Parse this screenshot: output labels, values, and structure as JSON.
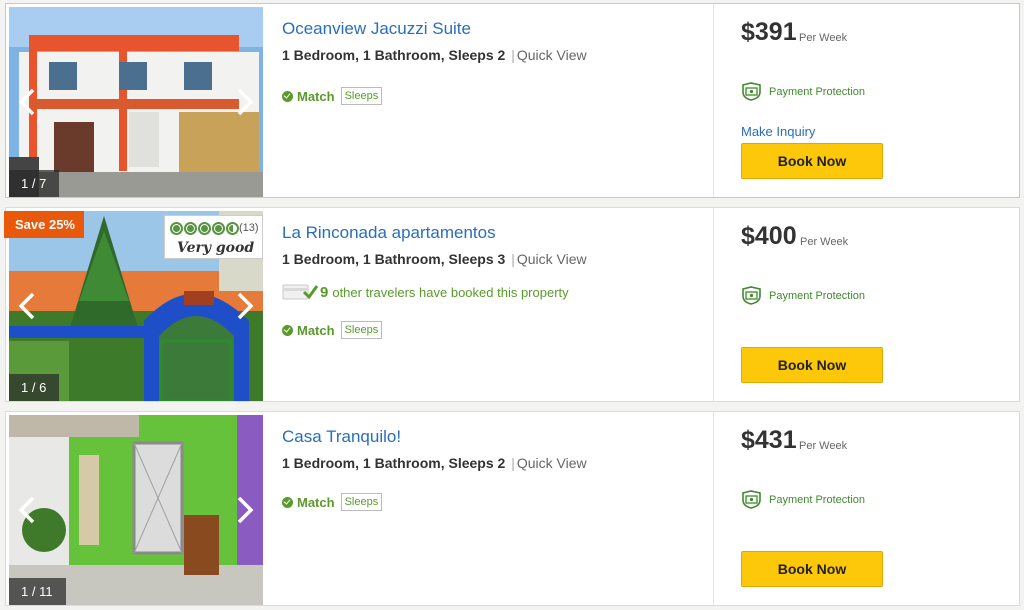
{
  "listings": [
    {
      "title": "Oceanview Jacuzzi Suite",
      "bedrooms": "1 Bedroom,",
      "bathrooms": "1 Bathroom,",
      "sleeps": "Sleeps 2",
      "quick_view": "Quick View",
      "match": "Match",
      "sleeps_tag": "Sleeps",
      "photo_counter": "1 / 7",
      "price": "$391",
      "per": "Per Week",
      "payment_protection": "Payment Protection",
      "make_inquiry": "Make Inquiry",
      "book_now": "Book Now"
    },
    {
      "title": "La Rinconada apartamentos",
      "bedrooms": "1 Bedroom,",
      "bathrooms": "1 Bathroom,",
      "sleeps": "Sleeps 3",
      "quick_view": "Quick View",
      "booked_count": "9",
      "booked_text": "other travelers have booked this property",
      "match": "Match",
      "sleeps_tag": "Sleeps",
      "photo_counter": "1 / 6",
      "save_badge": "Save 25%",
      "rating_count": "(13)",
      "rating_label": "Very good",
      "rating_value": 4.5,
      "price": "$400",
      "per": "Per Week",
      "payment_protection": "Payment Protection",
      "book_now": "Book Now"
    },
    {
      "title": "Casa Tranquilo!",
      "bedrooms": "1 Bedroom,",
      "bathrooms": "1 Bathroom,",
      "sleeps": "Sleeps 2",
      "quick_view": "Quick View",
      "match": "Match",
      "sleeps_tag": "Sleeps",
      "photo_counter": "1 / 11",
      "price": "$431",
      "per": "Per Week",
      "payment_protection": "Payment Protection",
      "book_now": "Book Now"
    }
  ],
  "colors": {
    "link": "#2a6ebb",
    "match_green": "#5a9a2c",
    "book_button": "#fdc70a",
    "save_badge": "#e8590c"
  },
  "icons": [
    "chevron-left-icon",
    "chevron-right-icon",
    "check-circle-icon",
    "payment-protection-icon",
    "credit-card-icon",
    "checkmark-icon",
    "rating-bubble-icon"
  ]
}
